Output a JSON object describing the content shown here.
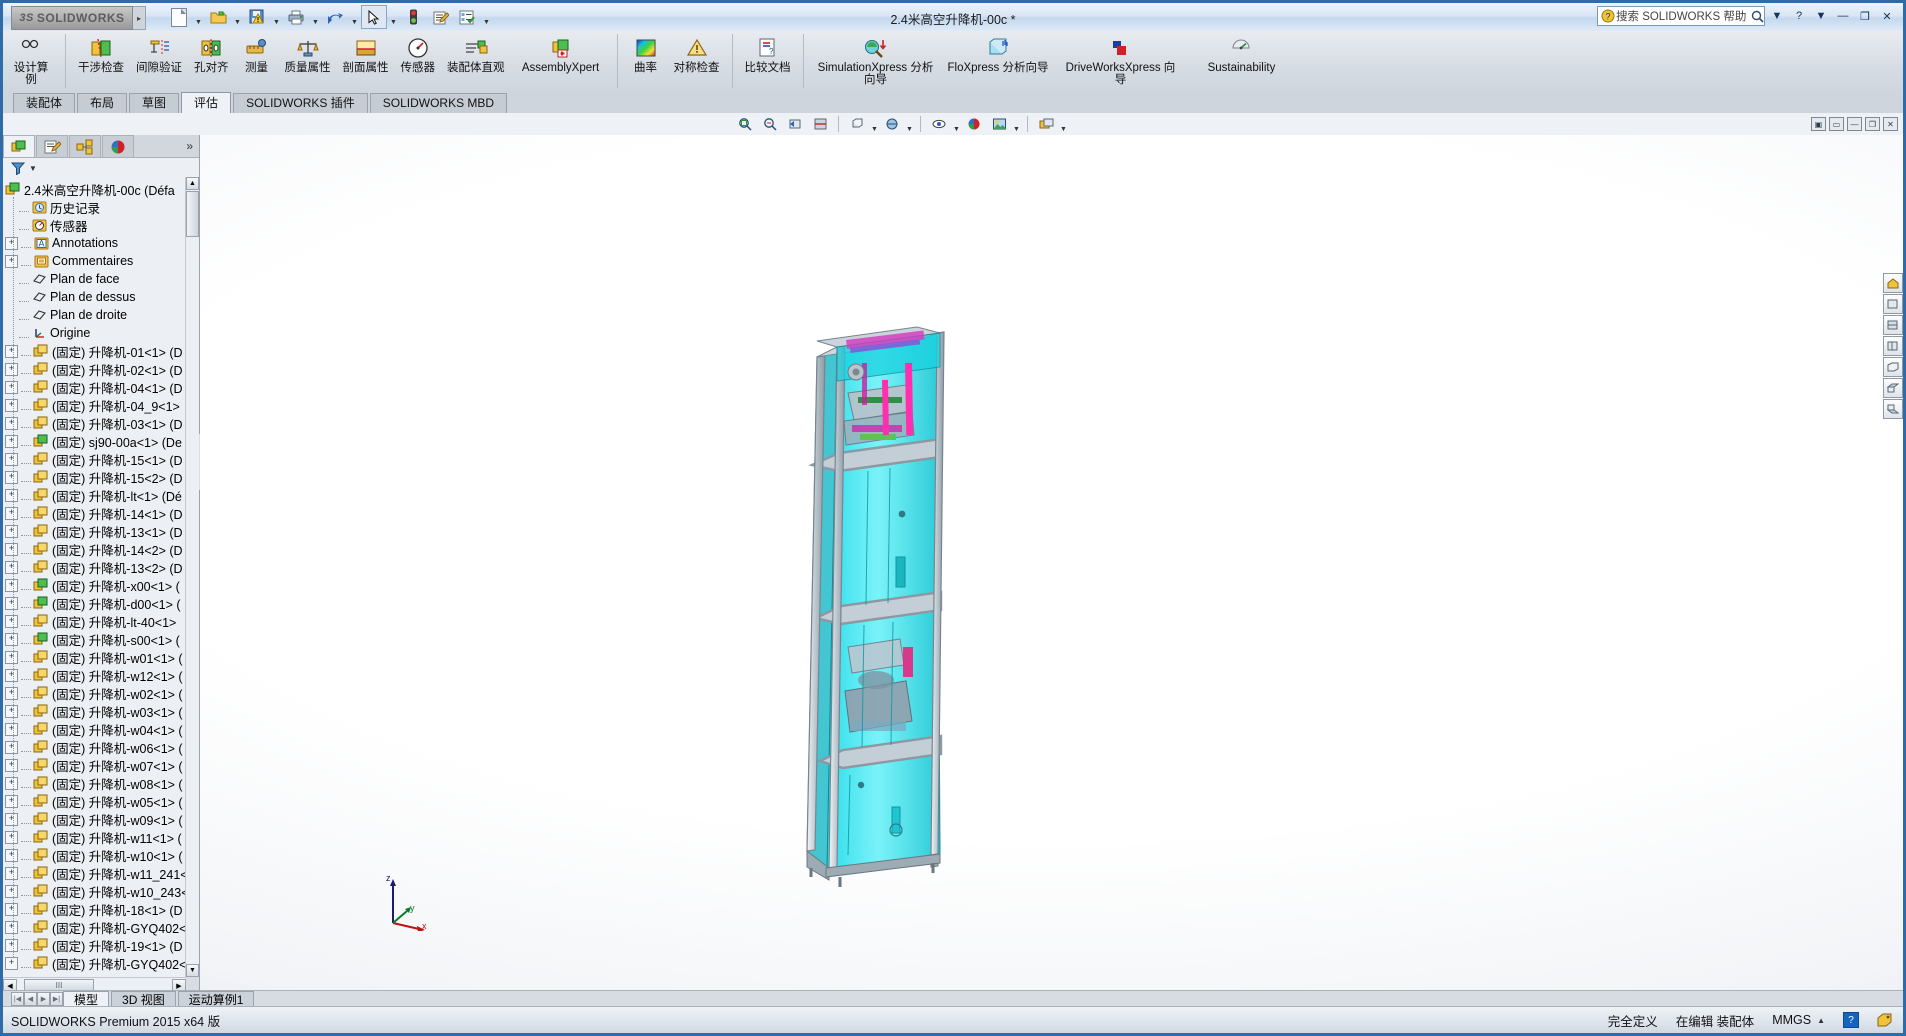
{
  "titlebar": {
    "logo_text": "SOLIDWORKS",
    "logo_mark": "3S",
    "document_title": "2.4米高空升降机-00c *",
    "search_placeholder": "搜索 SOLIDWORKS 帮助",
    "quick_access": [
      {
        "name": "new-document",
        "icon": "new-file-icon",
        "has_caret": true
      },
      {
        "name": "open-document",
        "icon": "open-folder-icon",
        "has_caret": true
      },
      {
        "name": "save-document",
        "icon": "save-warning-icon",
        "has_caret": true
      },
      {
        "name": "print-document",
        "icon": "printer-icon",
        "has_caret": true
      },
      {
        "name": "undo",
        "icon": "undo-arrow-icon",
        "has_caret": true
      },
      {
        "name": "select",
        "icon": "cursor-arrow-icon",
        "has_caret": true,
        "selected": true
      },
      {
        "name": "rebuild",
        "icon": "traffic-light-icon",
        "has_caret": false
      },
      {
        "name": "file-properties",
        "icon": "properties-icon",
        "has_caret": false
      },
      {
        "name": "options",
        "icon": "options-list-icon",
        "has_caret": true
      }
    ],
    "window_buttons": [
      "help-question",
      "help-caret",
      "minimize",
      "maximize",
      "close"
    ]
  },
  "command_manager": {
    "items": [
      {
        "label": "设计算例",
        "icon": "design-study-icon",
        "first": true
      },
      {
        "label": "干涉检查",
        "icon": "interference-check-icon"
      },
      {
        "label": "间隙验证",
        "icon": "clearance-verify-icon"
      },
      {
        "label": "孔对齐",
        "icon": "hole-alignment-icon"
      },
      {
        "label": "测量",
        "icon": "measure-icon"
      },
      {
        "label": "质量属性",
        "icon": "mass-properties-icon"
      },
      {
        "label": "剖面属性",
        "icon": "section-properties-icon"
      },
      {
        "label": "传感器",
        "icon": "sensor-icon"
      },
      {
        "label": "装配体直观",
        "icon": "assembly-visualization-icon"
      },
      {
        "label": "AssemblyXpert",
        "icon": "assembly-xpert-icon",
        "wide": true
      },
      {
        "divider": true
      },
      {
        "label": "曲率",
        "icon": "curvature-icon"
      },
      {
        "label": "对称检查",
        "icon": "symmetry-check-icon"
      },
      {
        "divider": true
      },
      {
        "label": "比较文档",
        "icon": "compare-documents-icon"
      },
      {
        "divider": true
      },
      {
        "label": "SimulationXpress 分析向导",
        "icon": "simulation-xpress-icon",
        "wide": true
      },
      {
        "label": "FloXpress 分析向导",
        "icon": "flo-xpress-icon",
        "wide": true
      },
      {
        "label": "DriveWorksXpress 向导",
        "icon": "driveworks-xpress-icon",
        "wide": true
      },
      {
        "label": "Sustainability",
        "icon": "sustainability-icon",
        "wide": true
      }
    ]
  },
  "ribbon_tabs": [
    {
      "label": "装配体",
      "active": false
    },
    {
      "label": "布局",
      "active": false
    },
    {
      "label": "草图",
      "active": false
    },
    {
      "label": "评估",
      "active": true
    },
    {
      "label": "SOLIDWORKS 插件",
      "active": false
    },
    {
      "label": "SOLIDWORKS MBD",
      "active": false
    }
  ],
  "view_toolbar": {
    "tools": [
      {
        "name": "zoom-to-fit-icon"
      },
      {
        "name": "zoom-to-area-icon"
      },
      {
        "name": "previous-view-icon"
      },
      {
        "name": "section-view-icon"
      },
      {
        "name": "divider"
      },
      {
        "name": "view-orientation-icon",
        "caret": true
      },
      {
        "name": "display-style-icon",
        "caret": true
      },
      {
        "name": "divider"
      },
      {
        "name": "hide-show-icon",
        "caret": true
      },
      {
        "name": "edit-appearance-icon"
      },
      {
        "name": "apply-scene-icon",
        "caret": true
      },
      {
        "name": "divider"
      },
      {
        "name": "view-settings-icon",
        "caret": true
      }
    ],
    "window_controls": [
      "tile-icon",
      "restore-icon",
      "minimize-icon",
      "maximize-icon",
      "close-icon"
    ]
  },
  "feature_tree": {
    "panel_tabs": [
      {
        "name": "feature-manager-tab",
        "icon": "feature-tree-icon",
        "active": true
      },
      {
        "name": "property-manager-tab",
        "icon": "property-manager-icon",
        "active": false
      },
      {
        "name": "configuration-manager-tab",
        "icon": "configuration-icon",
        "active": false
      },
      {
        "name": "display-manager-tab",
        "icon": "display-manager-icon",
        "active": false
      }
    ],
    "more_glyph": "»",
    "filter_icon": "filter-funnel-icon",
    "root": {
      "label": "2.4米高空升降机-00c  (Défa",
      "icon": "assembly-icon"
    },
    "items": [
      {
        "label": "历史记录",
        "icon": "history-icon",
        "expandable": false,
        "indent": 1
      },
      {
        "label": "传感器",
        "icon": "sensors-icon",
        "expandable": false,
        "indent": 1
      },
      {
        "label": "Annotations",
        "icon": "annotations-icon",
        "expandable": true,
        "indent": 1
      },
      {
        "label": "Commentaires",
        "icon": "comments-icon",
        "expandable": true,
        "indent": 1
      },
      {
        "label": "Plan de face",
        "icon": "plane-icon",
        "expandable": false,
        "indent": 1
      },
      {
        "label": "Plan de dessus",
        "icon": "plane-icon",
        "expandable": false,
        "indent": 1
      },
      {
        "label": "Plan de droite",
        "icon": "plane-icon",
        "expandable": false,
        "indent": 1
      },
      {
        "label": "Origine",
        "icon": "origin-icon",
        "expandable": false,
        "indent": 1
      },
      {
        "label": "(固定) 升降机-01<1> (D",
        "icon": "part-icon",
        "expandable": true,
        "indent": 1
      },
      {
        "label": "(固定) 升降机-02<1> (D",
        "icon": "part-icon",
        "expandable": true,
        "indent": 1
      },
      {
        "label": "(固定) 升降机-04<1> (D",
        "icon": "part-icon",
        "expandable": true,
        "indent": 1
      },
      {
        "label": "(固定) 升降机-04_9<1>",
        "icon": "part-icon",
        "expandable": true,
        "indent": 1
      },
      {
        "label": "(固定) 升降机-03<1> (D",
        "icon": "part-icon",
        "expandable": true,
        "indent": 1
      },
      {
        "label": "(固定) sj90-00a<1> (De",
        "icon": "part-green-icon",
        "expandable": true,
        "indent": 1
      },
      {
        "label": "(固定) 升降机-15<1> (D",
        "icon": "part-icon",
        "expandable": true,
        "indent": 1
      },
      {
        "label": "(固定) 升降机-15<2> (D",
        "icon": "part-icon",
        "expandable": true,
        "indent": 1
      },
      {
        "label": "(固定) 升降机-lt<1> (Dé",
        "icon": "part-icon",
        "expandable": true,
        "indent": 1
      },
      {
        "label": "(固定) 升降机-14<1> (D",
        "icon": "part-icon",
        "expandable": true,
        "indent": 1
      },
      {
        "label": "(固定) 升降机-13<1> (D",
        "icon": "part-icon",
        "expandable": true,
        "indent": 1
      },
      {
        "label": "(固定) 升降机-14<2> (D",
        "icon": "part-icon",
        "expandable": true,
        "indent": 1
      },
      {
        "label": "(固定) 升降机-13<2> (D",
        "icon": "part-icon",
        "expandable": true,
        "indent": 1
      },
      {
        "label": "(固定) 升降机-x00<1>  (",
        "icon": "part-green-icon",
        "expandable": true,
        "indent": 1
      },
      {
        "label": "(固定) 升降机-d00<1> (",
        "icon": "part-green-icon",
        "expandable": true,
        "indent": 1
      },
      {
        "label": "(固定) 升降机-lt-40<1>",
        "icon": "part-icon",
        "expandable": true,
        "indent": 1
      },
      {
        "label": "(固定) 升降机-s00<1> (",
        "icon": "part-green-icon",
        "expandable": true,
        "indent": 1
      },
      {
        "label": "(固定) 升降机-w01<1> (",
        "icon": "part-icon",
        "expandable": true,
        "indent": 1
      },
      {
        "label": "(固定) 升降机-w12<1> (",
        "icon": "part-icon",
        "expandable": true,
        "indent": 1
      },
      {
        "label": "(固定) 升降机-w02<1> (",
        "icon": "part-icon",
        "expandable": true,
        "indent": 1
      },
      {
        "label": "(固定) 升降机-w03<1> (",
        "icon": "part-icon",
        "expandable": true,
        "indent": 1
      },
      {
        "label": "(固定) 升降机-w04<1> (",
        "icon": "part-icon",
        "expandable": true,
        "indent": 1
      },
      {
        "label": "(固定) 升降机-w06<1> (",
        "icon": "part-icon",
        "expandable": true,
        "indent": 1
      },
      {
        "label": "(固定) 升降机-w07<1> (",
        "icon": "part-icon",
        "expandable": true,
        "indent": 1
      },
      {
        "label": "(固定) 升降机-w08<1> (",
        "icon": "part-icon",
        "expandable": true,
        "indent": 1
      },
      {
        "label": "(固定) 升降机-w05<1> (",
        "icon": "part-icon",
        "expandable": true,
        "indent": 1
      },
      {
        "label": "(固定) 升降机-w09<1> (",
        "icon": "part-icon",
        "expandable": true,
        "indent": 1
      },
      {
        "label": "(固定) 升降机-w11<1> (",
        "icon": "part-icon",
        "expandable": true,
        "indent": 1
      },
      {
        "label": "(固定) 升降机-w10<1> (",
        "icon": "part-icon",
        "expandable": true,
        "indent": 1
      },
      {
        "label": "(固定) 升降机-w11_241<",
        "icon": "part-icon",
        "expandable": true,
        "indent": 1
      },
      {
        "label": "(固定) 升降机-w10_243<",
        "icon": "part-icon",
        "expandable": true,
        "indent": 1
      },
      {
        "label": "(固定) 升降机-18<1> (D",
        "icon": "part-icon",
        "expandable": true,
        "indent": 1
      },
      {
        "label": "(固定) 升降机-GYQ402<",
        "icon": "part-icon",
        "expandable": true,
        "indent": 1
      },
      {
        "label": "(固定) 升降机-19<1> (D",
        "icon": "part-icon",
        "expandable": true,
        "indent": 1
      },
      {
        "label": "(固定) 升降机-GYQ402<",
        "icon": "part-icon",
        "expandable": true,
        "indent": 1
      }
    ],
    "hscroll_glyph": "III"
  },
  "graphics": {
    "triad": {
      "z_label": "z",
      "y_label": "y",
      "x_label": "x"
    },
    "model_colors": {
      "glass": "#19e0e6",
      "frame": "#b9c4cc",
      "magenta": "#ff2fb0",
      "purple": "#8a4fd8",
      "green": "#2fbf4f",
      "teal_dark": "#0fa6ad"
    },
    "right_toolbar": [
      {
        "name": "view-home-icon"
      },
      {
        "name": "view-front-icon"
      },
      {
        "name": "view-back-icon"
      },
      {
        "name": "view-left-icon"
      },
      {
        "name": "view-right-icon"
      },
      {
        "name": "view-top-icon"
      },
      {
        "name": "view-bottom-icon"
      }
    ]
  },
  "bottom_tabs": [
    {
      "label": "模型",
      "active": true
    },
    {
      "label": "3D 视图",
      "active": false
    },
    {
      "label": "运动算例1",
      "active": false
    }
  ],
  "nav_buttons": [
    "first-page",
    "previous-page",
    "next-page",
    "last-page"
  ],
  "statusbar": {
    "left_text": "SOLIDWORKS Premium 2015 x64 版",
    "definition_state": "完全定义",
    "edit_state": "在编辑 装配体",
    "units": "MMGS",
    "units_caret": "▲",
    "help_badge": "?",
    "tag_icon": "tag-icon"
  }
}
